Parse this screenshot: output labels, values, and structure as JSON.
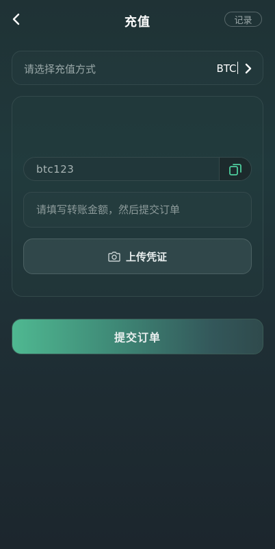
{
  "header": {
    "title": "充值",
    "record_label": "记录"
  },
  "method": {
    "label": "请选择充值方式",
    "value": "BTC"
  },
  "address": {
    "value": "btc123"
  },
  "amount": {
    "placeholder": "请填写转账金额，然后提交订单"
  },
  "upload": {
    "label": "上传凭证"
  },
  "submit": {
    "label": "提交订单"
  },
  "icons": {
    "back": "chevron-left-icon",
    "chevron": "chevron-right-icon",
    "copy": "copy-icon",
    "camera": "camera-icon"
  },
  "colors": {
    "accent_green": "#4fb891",
    "copy_icon": "#4ecf9e"
  }
}
